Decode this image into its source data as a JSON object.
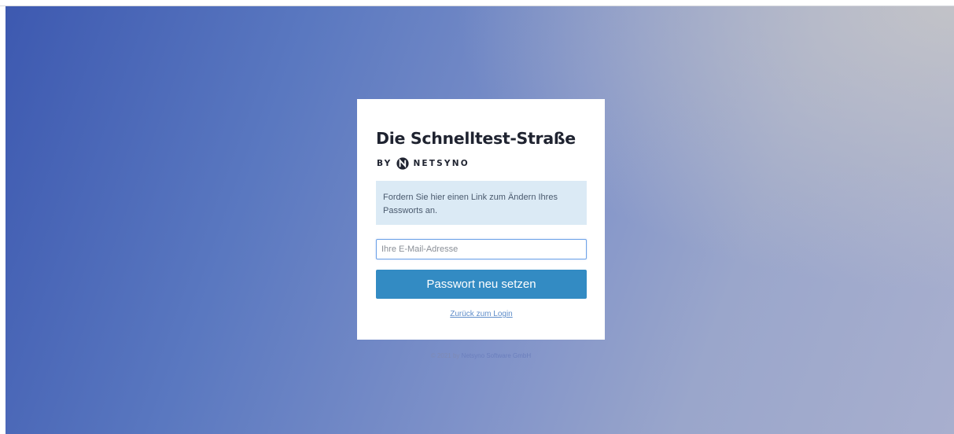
{
  "brand": {
    "title": "Die Schnelltest-Straße",
    "by_label": "BY",
    "company_name": "NETSYNO"
  },
  "info": {
    "text": "Fordern Sie hier einen Link zum Ändern Ihres Passworts an."
  },
  "form": {
    "email_placeholder": "Ihre E-Mail-Adresse",
    "email_value": "",
    "submit_label": "Passwort neu setzen"
  },
  "links": {
    "back_to_login": "Zurück zum Login"
  },
  "footer": {
    "copyright": "© 2021 by",
    "company_link": "Netsyno Software GmbH"
  },
  "colors": {
    "primary_button": "#338bc3",
    "info_background": "#dbeaf5",
    "gradient_start": "#3d59b0",
    "gradient_end": "#c4c4c8"
  },
  "icons": {
    "logo": "netsyno-logo-icon"
  }
}
